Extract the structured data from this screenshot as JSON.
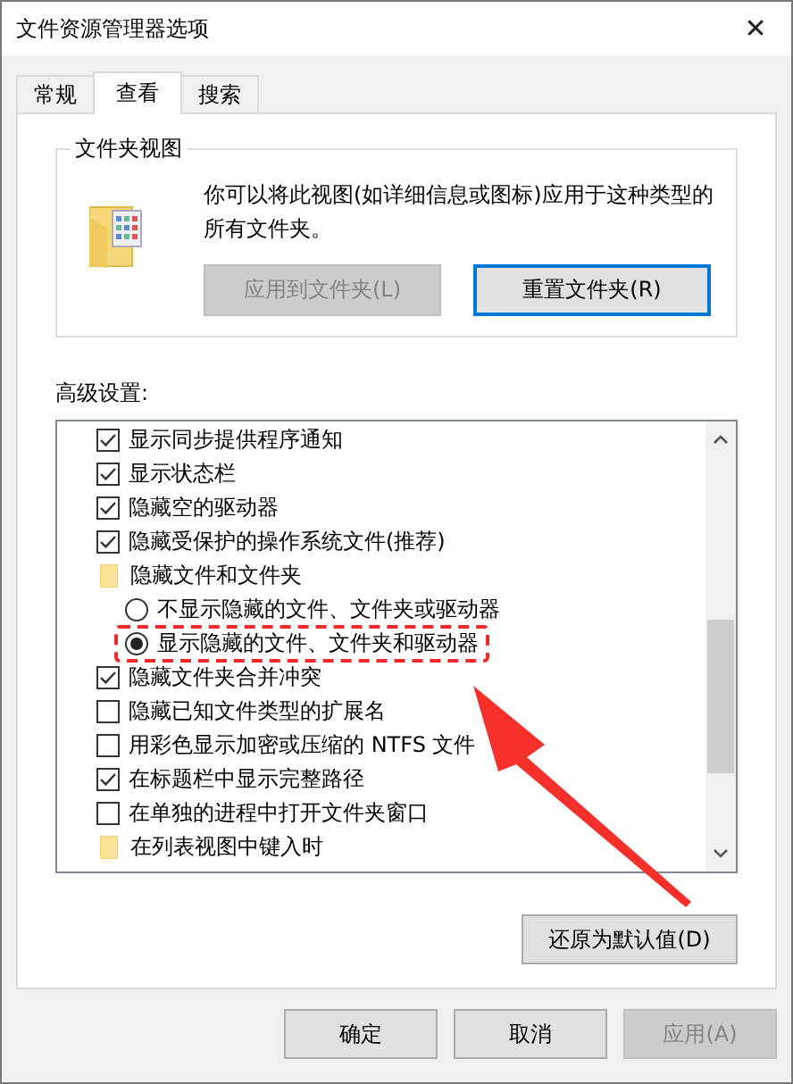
{
  "window": {
    "title": "文件资源管理器选项",
    "close": "✕"
  },
  "tabs": [
    {
      "label": "常规",
      "selected": false
    },
    {
      "label": "查看",
      "selected": true
    },
    {
      "label": "搜索",
      "selected": false
    }
  ],
  "folder_views": {
    "title": "文件夹视图",
    "description": "你可以将此视图(如详细信息或图标)应用于这种类型的所有文件夹。",
    "buttons": [
      {
        "label": "应用到文件夹(L)",
        "disabled": true,
        "focused": false
      },
      {
        "label": "重置文件夹(R)",
        "disabled": false,
        "focused": true
      }
    ]
  },
  "advanced": {
    "label": "高级设置:",
    "items": [
      {
        "kind": "checkbox",
        "label": "显示同步提供程序通知",
        "checked": true
      },
      {
        "kind": "checkbox",
        "label": "显示状态栏",
        "checked": true
      },
      {
        "kind": "checkbox",
        "label": "隐藏空的驱动器",
        "checked": true
      },
      {
        "kind": "checkbox",
        "label": "隐藏受保护的操作系统文件(推荐)",
        "checked": true
      },
      {
        "kind": "folder",
        "label": "隐藏文件和文件夹",
        "children": [
          {
            "kind": "radio",
            "label": "不显示隐藏的文件、文件夹或驱动器",
            "selected": false,
            "highlighted": false
          },
          {
            "kind": "radio",
            "label": "显示隐藏的文件、文件夹和驱动器",
            "selected": true,
            "highlighted": true
          }
        ]
      },
      {
        "kind": "checkbox",
        "label": "隐藏文件夹合并冲突",
        "checked": true
      },
      {
        "kind": "checkbox",
        "label": "隐藏已知文件类型的扩展名",
        "checked": false
      },
      {
        "kind": "checkbox",
        "label": "用彩色显示加密或压缩的 NTFS 文件",
        "checked": false
      },
      {
        "kind": "checkbox",
        "label": "在标题栏中显示完整路径",
        "checked": true
      },
      {
        "kind": "checkbox",
        "label": "在单独的进程中打开文件夹窗口",
        "checked": false
      },
      {
        "kind": "folder",
        "label": "在列表视图中键入时"
      }
    ],
    "restore_button": "还原为默认值(D)"
  },
  "footer_buttons": [
    {
      "label": "确定",
      "disabled": false
    },
    {
      "label": "取消",
      "disabled": false
    },
    {
      "label": "应用(A)",
      "disabled": true
    }
  ]
}
